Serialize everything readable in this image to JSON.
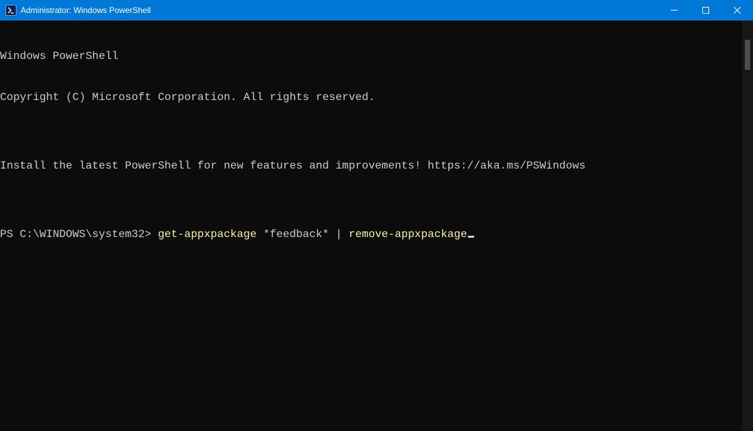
{
  "titlebar": {
    "title": "Administrator: Windows PowerShell"
  },
  "terminal": {
    "banner_line1": "Windows PowerShell",
    "banner_line2": "Copyright (C) Microsoft Corporation. All rights reserved.",
    "banner_blank1": "",
    "banner_line3": "Install the latest PowerShell for new features and improvements! https://aka.ms/PSWindows",
    "banner_blank2": "",
    "prompt_prefix": "PS C:\\WINDOWS\\system32> ",
    "command": {
      "part1": "get-appxpackage",
      "part2": " *feedback* ",
      "part3": "|",
      "part4": " ",
      "part5": "remove-appxpackage"
    }
  }
}
